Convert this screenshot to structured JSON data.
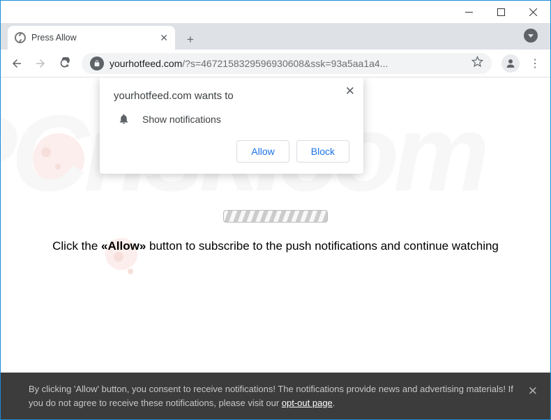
{
  "window": {
    "min": "_",
    "max": "□",
    "close": "×"
  },
  "tab": {
    "title": "Press Allow"
  },
  "url": {
    "domain": "yourhotfeed.com",
    "path": "/?s=4672158329596930608&ssk=93a5aa1a4..."
  },
  "permission": {
    "head": "yourhotfeed.com wants to",
    "line": "Show notifications",
    "allow": "Allow",
    "block": "Block"
  },
  "main": {
    "pre": "Click the ",
    "bold": "«Allow»",
    "post": " button to subscribe to the push notifications and continue watching"
  },
  "footer": {
    "text1": "By clicking 'Allow' button, you consent to receive notifications! The notifications provide news and advertising materials! If you do not agree to receive these notifications, please visit our ",
    "link": "opt-out page",
    "text2": "."
  },
  "watermark": "PCrisk.com"
}
